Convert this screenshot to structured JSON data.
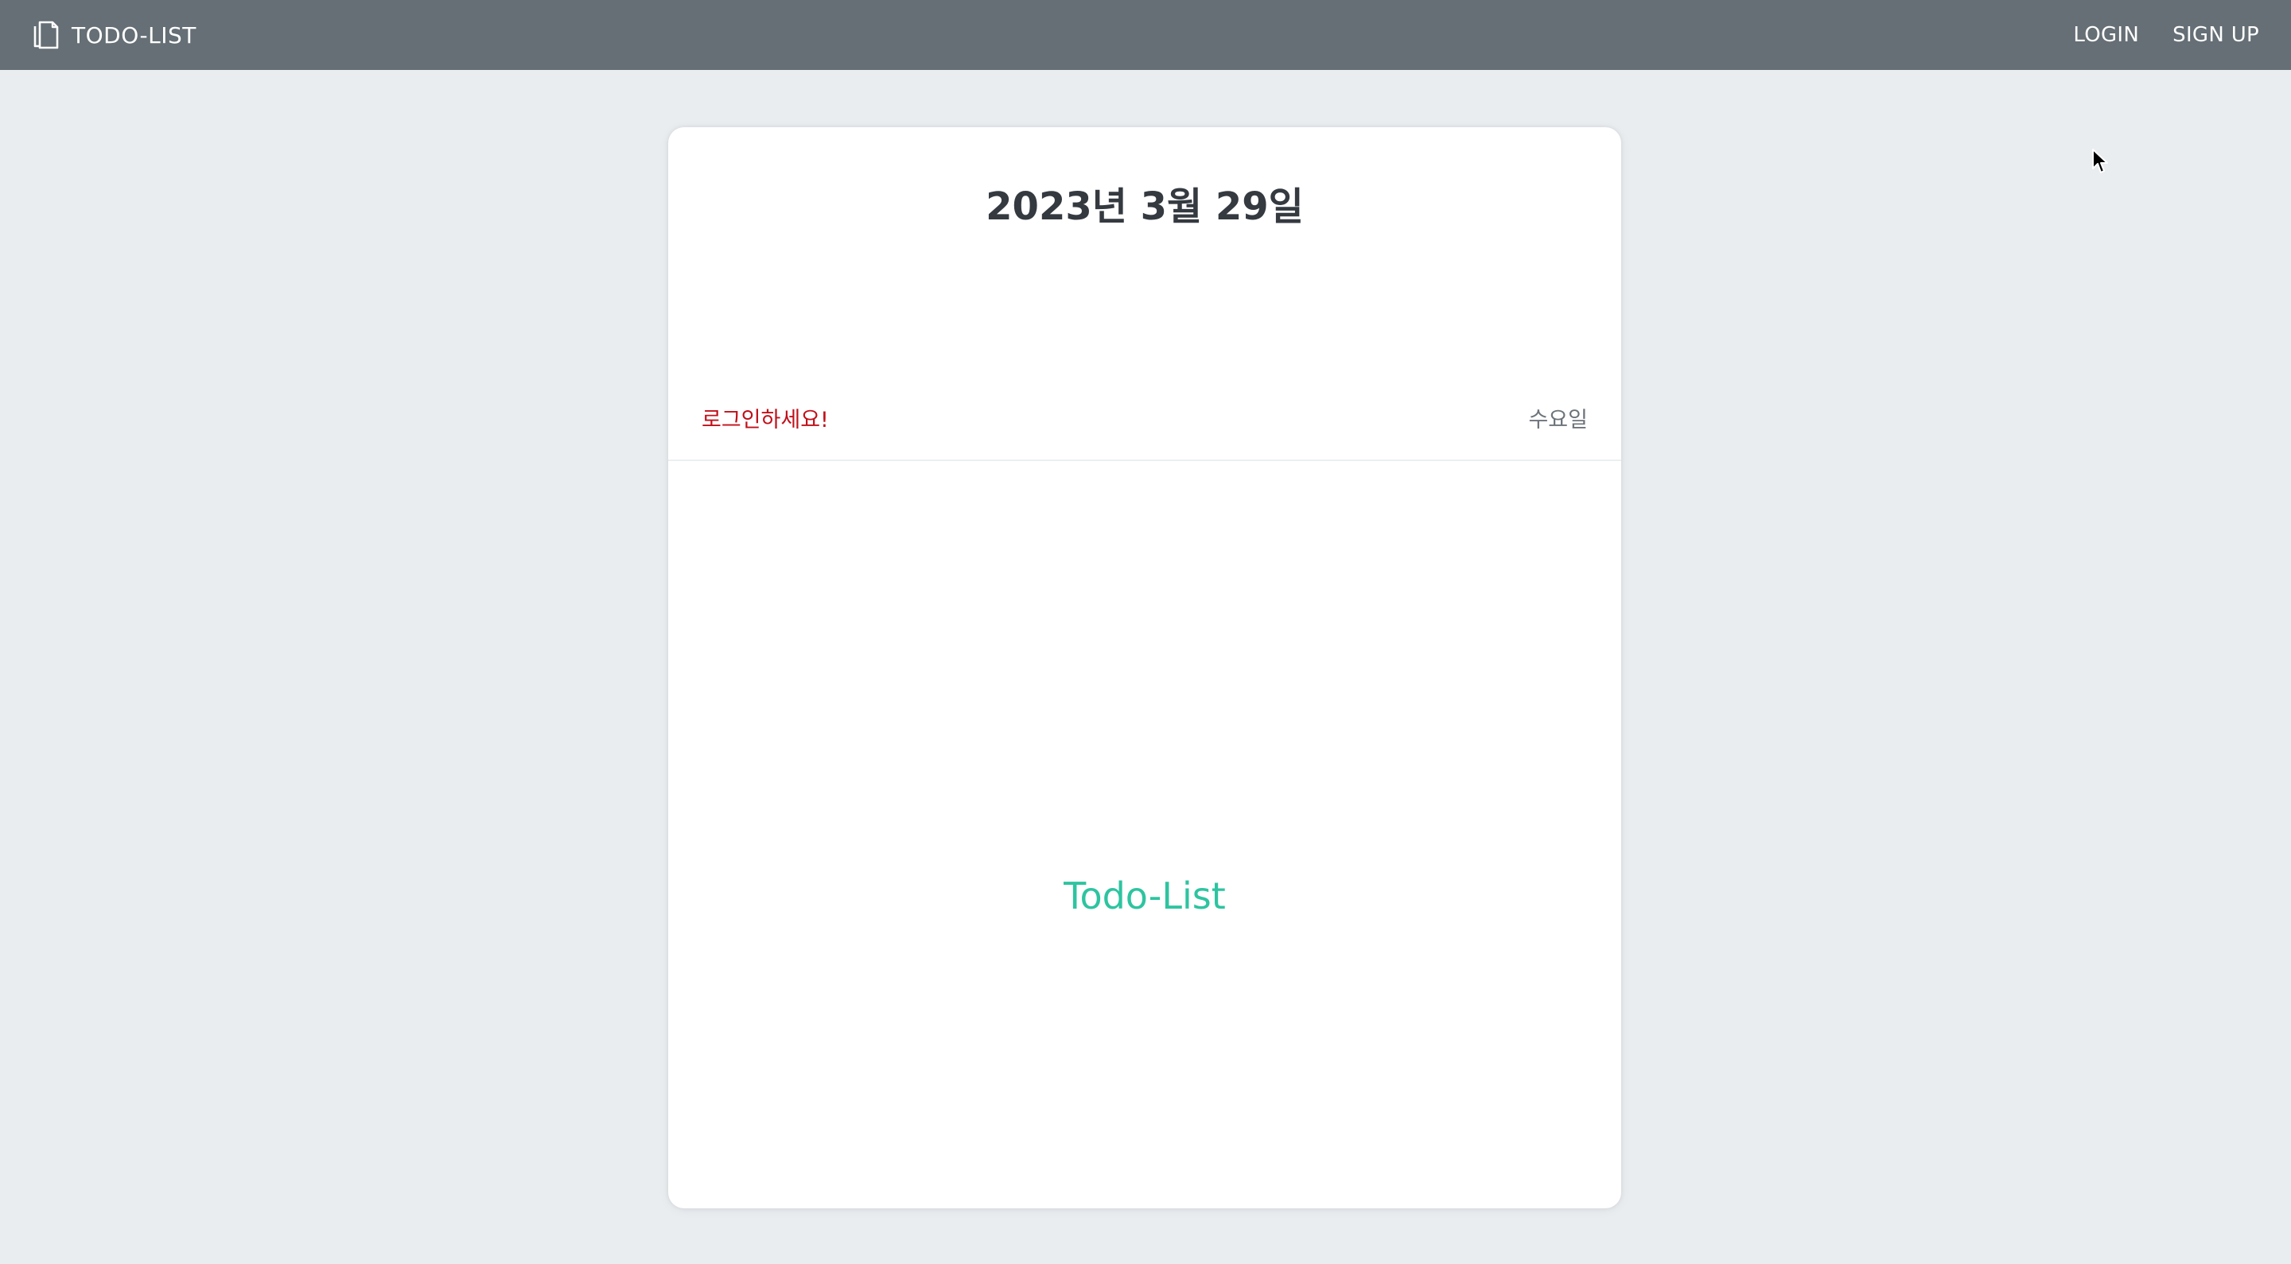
{
  "navbar": {
    "brand": {
      "icon": "document-icon",
      "label": "TODO-LIST"
    },
    "links": {
      "login": "LOGIN",
      "signup": "SIGN UP"
    }
  },
  "card": {
    "date_title": "2023년 3월 29일",
    "login_message": "로그인하세요!",
    "weekday": "수요일",
    "center_label": "Todo-List"
  },
  "colors": {
    "navbar_bg": "#656f75",
    "page_bg": "#e9edf0",
    "error_text": "#c0101a",
    "accent_green": "#2ec4a0"
  }
}
